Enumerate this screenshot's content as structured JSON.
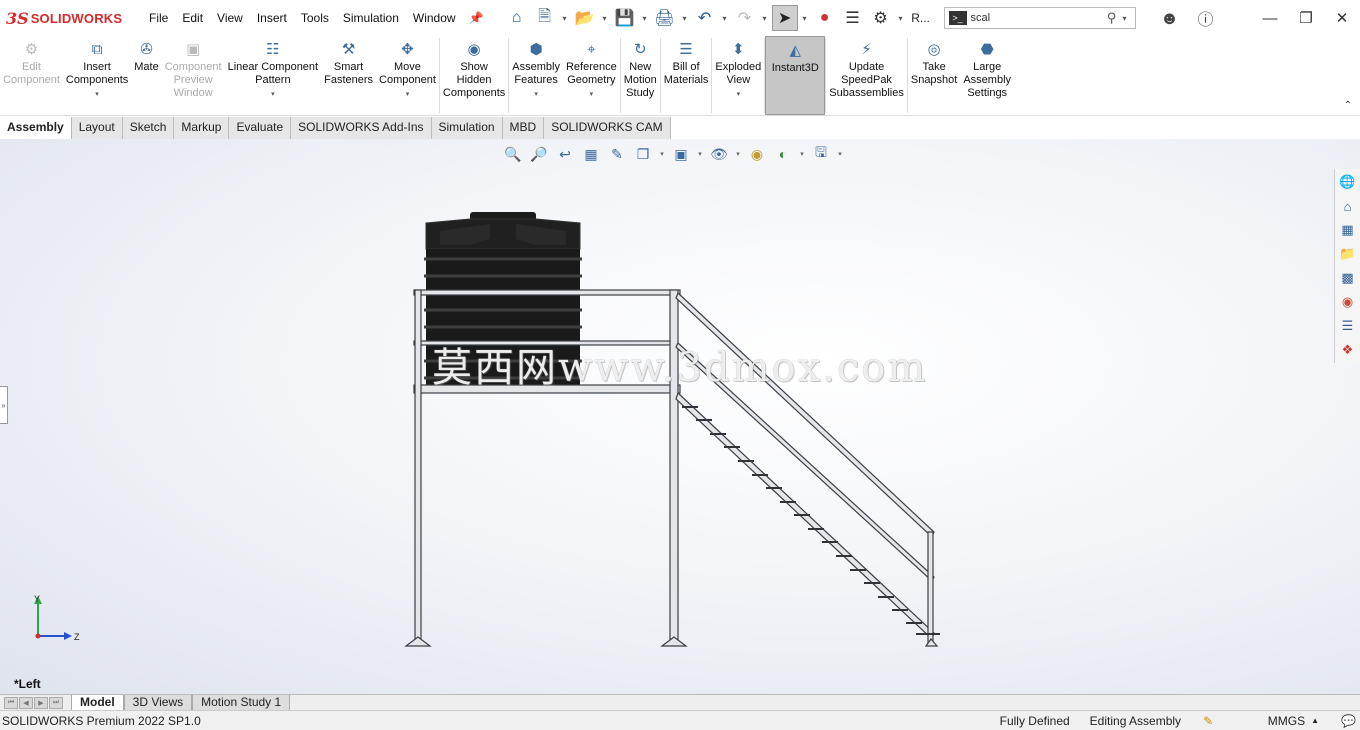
{
  "app": {
    "logo_ds": "3S",
    "logo_text": "SOLIDWORKS"
  },
  "menu": [
    "File",
    "Edit",
    "View",
    "Insert",
    "Tools",
    "Simulation",
    "Window"
  ],
  "quick_access": {
    "rebuild_label": "R..."
  },
  "search": {
    "value": "scal"
  },
  "command_manager": [
    {
      "label": "Edit Component",
      "lines": [
        "Edit",
        "Component"
      ],
      "disabled": true,
      "dropdown": false,
      "icon": "edit-component-icon"
    },
    {
      "label": "Insert Components",
      "lines": [
        "Insert",
        "Components"
      ],
      "disabled": false,
      "dropdown": true,
      "icon": "insert-components-icon"
    },
    {
      "label": "Mate",
      "lines": [
        "Mate"
      ],
      "disabled": false,
      "dropdown": false,
      "icon": "mate-icon"
    },
    {
      "label": "Component Preview Window",
      "lines": [
        "Component",
        "Preview",
        "Window"
      ],
      "disabled": true,
      "dropdown": false,
      "icon": "component-preview-icon"
    },
    {
      "label": "Linear Component Pattern",
      "lines": [
        "Linear Component",
        "Pattern"
      ],
      "disabled": false,
      "dropdown": true,
      "icon": "linear-pattern-icon"
    },
    {
      "label": "Smart Fasteners",
      "lines": [
        "Smart",
        "Fasteners"
      ],
      "disabled": false,
      "dropdown": false,
      "icon": "smart-fasteners-icon"
    },
    {
      "label": "Move Component",
      "lines": [
        "Move",
        "Component"
      ],
      "disabled": false,
      "dropdown": true,
      "icon": "move-component-icon"
    },
    {
      "label": "Show Hidden Components",
      "lines": [
        "Show",
        "Hidden",
        "Components"
      ],
      "disabled": false,
      "dropdown": false,
      "icon": "show-hidden-icon"
    },
    {
      "label": "Assembly Features",
      "lines": [
        "Assembly",
        "Features"
      ],
      "disabled": false,
      "dropdown": true,
      "icon": "assembly-features-icon"
    },
    {
      "label": "Reference Geometry",
      "lines": [
        "Reference",
        "Geometry"
      ],
      "disabled": false,
      "dropdown": true,
      "icon": "reference-geometry-icon"
    },
    {
      "label": "New Motion Study",
      "lines": [
        "New",
        "Motion",
        "Study"
      ],
      "disabled": false,
      "dropdown": false,
      "icon": "motion-study-icon"
    },
    {
      "label": "Bill of Materials",
      "lines": [
        "Bill of",
        "Materials"
      ],
      "disabled": false,
      "dropdown": false,
      "icon": "bom-icon"
    },
    {
      "label": "Exploded View",
      "lines": [
        "Exploded",
        "View"
      ],
      "disabled": false,
      "dropdown": true,
      "icon": "exploded-view-icon"
    },
    {
      "label": "Instant3D",
      "lines": [
        "Instant3D"
      ],
      "disabled": false,
      "dropdown": false,
      "active": true,
      "icon": "instant3d-icon"
    },
    {
      "label": "Update SpeedPak Subassemblies",
      "lines": [
        "Update",
        "SpeedPak",
        "Subassemblies"
      ],
      "disabled": false,
      "dropdown": false,
      "icon": "speedpak-icon"
    },
    {
      "label": "Take Snapshot",
      "lines": [
        "Take",
        "Snapshot"
      ],
      "disabled": false,
      "dropdown": false,
      "icon": "snapshot-icon"
    },
    {
      "label": "Large Assembly Settings",
      "lines": [
        "Large",
        "Assembly",
        "Settings"
      ],
      "disabled": false,
      "dropdown": false,
      "icon": "large-assembly-icon"
    }
  ],
  "tabs": [
    "Assembly",
    "Layout",
    "Sketch",
    "Markup",
    "Evaluate",
    "SOLIDWORKS Add-Ins",
    "Simulation",
    "MBD",
    "SOLIDWORKS CAM"
  ],
  "active_tab": "Assembly",
  "viewport": {
    "view_name": "*Left",
    "watermark": "莫西网www.3dmox.com",
    "triad_y": "Y",
    "triad_z": "Z"
  },
  "bottom_tabs": [
    "Model",
    "3D Views",
    "Motion Study 1"
  ],
  "active_bottom_tab": "Model",
  "status": {
    "product": "SOLIDWORKS Premium 2022 SP1.0",
    "state": "Fully Defined",
    "mode": "Editing Assembly",
    "units": "MMGS"
  },
  "colors": {
    "accent": "#d62a2a",
    "tank": "#1a1a1a",
    "frame": "#7a7f86"
  }
}
